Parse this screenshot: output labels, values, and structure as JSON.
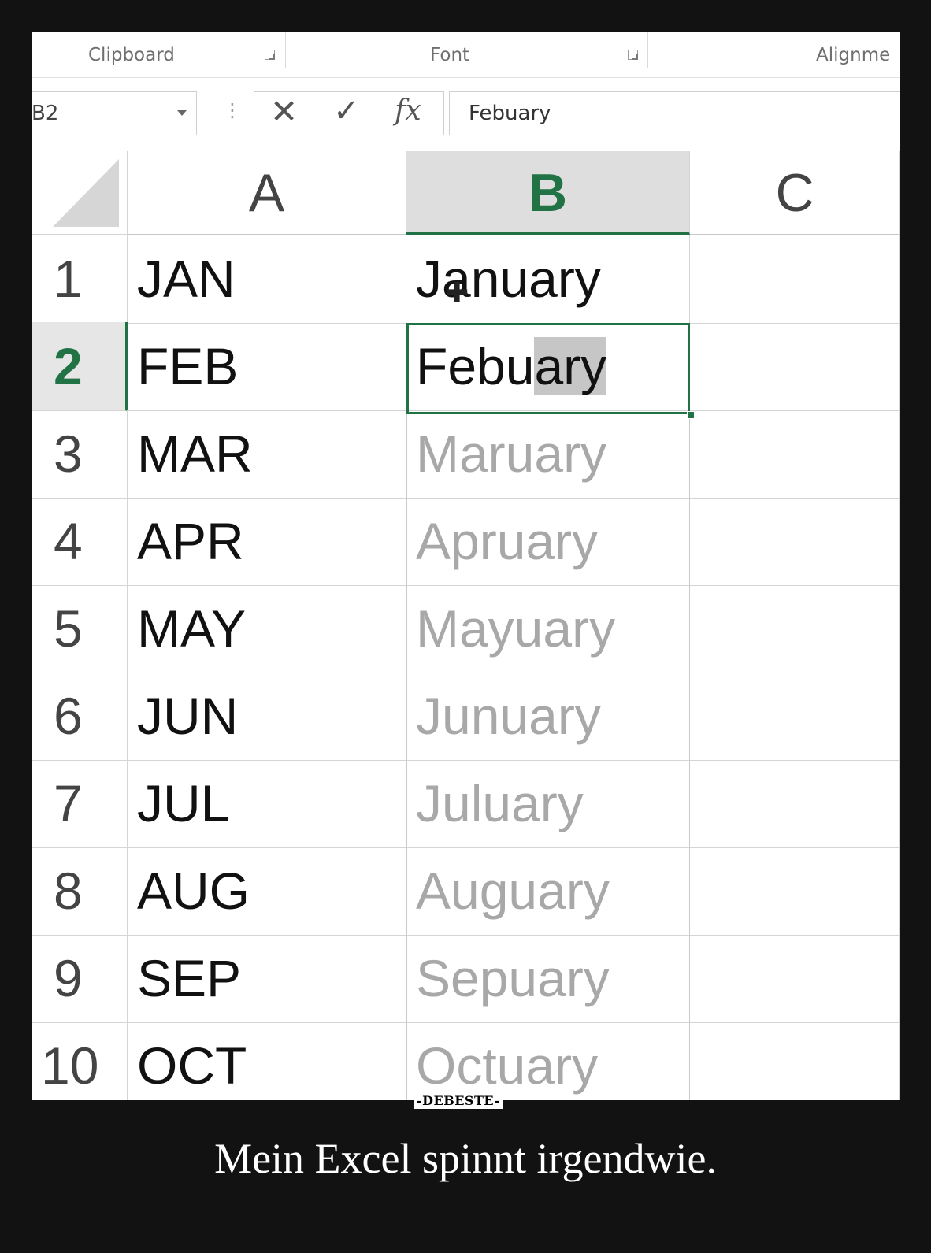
{
  "ribbon": {
    "groups": [
      {
        "label": "Clipboard"
      },
      {
        "label": "Font"
      },
      {
        "label": "Alignme"
      }
    ]
  },
  "formula_bar": {
    "name_box": "B2",
    "cancel_icon": "✕",
    "enter_icon": "✓",
    "fx_label": "fx",
    "content": "Febuary"
  },
  "columns": [
    "A",
    "B",
    "C"
  ],
  "selected_column": "B",
  "selected_row": "2",
  "rows": [
    {
      "num": "1",
      "a": "JAN",
      "b": "January",
      "ghost": false
    },
    {
      "num": "2",
      "a": "FEB",
      "b": "Febuary",
      "ghost": false
    },
    {
      "num": "3",
      "a": "MAR",
      "b": "Maruary",
      "ghost": true
    },
    {
      "num": "4",
      "a": "APR",
      "b": "Apruary",
      "ghost": true
    },
    {
      "num": "5",
      "a": "MAY",
      "b": "Mayuary",
      "ghost": true
    },
    {
      "num": "6",
      "a": "JUN",
      "b": "Junuary",
      "ghost": true
    },
    {
      "num": "7",
      "a": "JUL",
      "b": "Juluary",
      "ghost": true
    },
    {
      "num": "8",
      "a": "AUG",
      "b": "Auguary",
      "ghost": true
    },
    {
      "num": "9",
      "a": "SEP",
      "b": "Sepuary",
      "ghost": true
    },
    {
      "num": "10",
      "a": "OCT",
      "b": "Octuary",
      "ghost": true
    }
  ],
  "row2_highlight": {
    "prefix": "Febu",
    "highlight": "ary"
  },
  "watermark": "-DEBESTE-",
  "caption": "Mein Excel spinnt irgendwie.",
  "colors": {
    "accent": "#217346",
    "ghost_text": "#a8a8a8",
    "background": "#121212"
  }
}
